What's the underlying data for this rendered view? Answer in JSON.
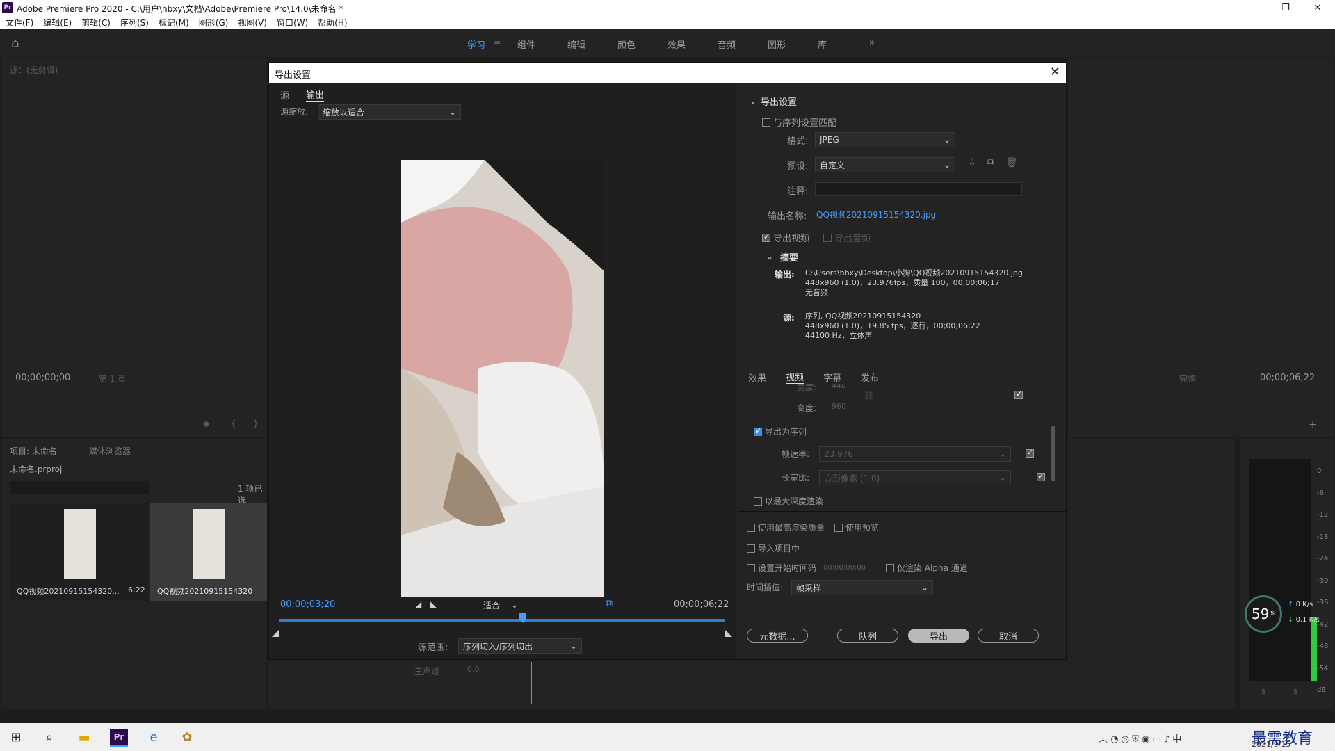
{
  "app": {
    "title": "Adobe Premiere Pro 2020 - C:\\用户\\hbxy\\文档\\Adobe\\Premiere Pro\\14.0\\未命名 *",
    "logo": "Pr"
  },
  "menu": [
    "文件(F)",
    "编辑(E)",
    "剪辑(C)",
    "序列(S)",
    "标记(M)",
    "图形(G)",
    "视图(V)",
    "窗口(W)",
    "帮助(H)"
  ],
  "workspaces": [
    "学习",
    "组件",
    "编辑",
    "颜色",
    "效果",
    "音频",
    "图形",
    "库"
  ],
  "source_panel": {
    "title": "源：(无剪辑)",
    "timecode": "00;00;00;00",
    "page": "第 1 页"
  },
  "program_panel": {
    "timecode": "00;00;06;22",
    "quality": "完整"
  },
  "project_panel": {
    "tabs": [
      "项目: 未命名",
      "媒体浏览器"
    ],
    "project_file": "未命名.prproj",
    "count": "1 项已选",
    "items": [
      {
        "name": "QQ视频20210915154320...",
        "duration": "6;22"
      },
      {
        "name": "QQ视频20210915154320",
        "duration": ""
      }
    ]
  },
  "timeline": {
    "master": "主声道",
    "value": "0.0"
  },
  "meter": {
    "labels": [
      "0",
      "-6",
      "-12",
      "-18",
      "-24",
      "-30",
      "-36",
      "-42",
      "-48",
      "-54",
      "dB"
    ],
    "footer": [
      "S",
      "S"
    ]
  },
  "net": {
    "percent": "59",
    "unit": "%",
    "up": "0",
    "up_unit": "K/s",
    "down": "0.1",
    "down_unit": "K/s"
  },
  "dialog": {
    "title": "导出设置",
    "close": "✕",
    "left": {
      "tabs": [
        "源",
        "输出"
      ],
      "scale_label": "源缩放:",
      "scale_value": "缩放以适合",
      "current_tc": "00;00;03;20",
      "fit": "适合",
      "end_tc": "00;00;06;22",
      "range_label": "源范围:",
      "range_value": "序列切入/序列切出"
    },
    "right": {
      "section": "导出设置",
      "match_label": "与序列设置匹配",
      "format_label": "格式:",
      "format_value": "JPEG",
      "preset_label": "预设:",
      "preset_value": "自定义",
      "comment_label": "注释:",
      "outname_label": "输出名称:",
      "outname_value": "QQ视频20210915154320.jpg",
      "export_video": "导出视频",
      "export_audio": "导出音频",
      "summary_title": "摘要",
      "summary_out_label": "输出:",
      "summary_out_lines": [
        "C:\\Users\\hbxy\\Desktop\\小狗\\QQ视频20210915154320.jpg",
        "448x960 (1.0)，23.976fps，质量 100，00;00;06;17",
        "无音频"
      ],
      "summary_src_label": "源:",
      "summary_src_lines": [
        "序列, QQ视频20210915154320",
        "448x960 (1.0)，19.85 fps，逐行，00;00;06;22",
        "44100 Hz，立体声"
      ],
      "tabs": [
        "效果",
        "视频",
        "字幕",
        "发布"
      ],
      "width_label": "宽度:",
      "width_value": "448",
      "height_label": "高度:",
      "height_value": "960",
      "export_seq": "导出为序列",
      "fps_label": "帧速率:",
      "fps_value": "23.976",
      "aspect_label": "长宽比:",
      "aspect_value": "方形像素 (1.0)",
      "maxdepth": "以最大深度渲染",
      "max_quality": "使用最高渲染质量",
      "use_preview": "使用预览",
      "import_project": "导入项目中",
      "start_tc": "设置开始时间码",
      "start_tc_value": "00;00;00;00",
      "alpha_only": "仅渲染 Alpha 通道",
      "interp_label": "时间插值:",
      "interp_value": "帧采样",
      "btn_meta": "元数据...",
      "btn_queue": "队列",
      "btn_export": "导出",
      "btn_cancel": "取消"
    }
  },
  "taskbar": {
    "date": "2021/9/15",
    "ime": "中",
    "watermark": "最需教育"
  },
  "colors": {
    "accent": "#3d9eff",
    "bg": "#1d1d1d",
    "panel": "#232323"
  }
}
